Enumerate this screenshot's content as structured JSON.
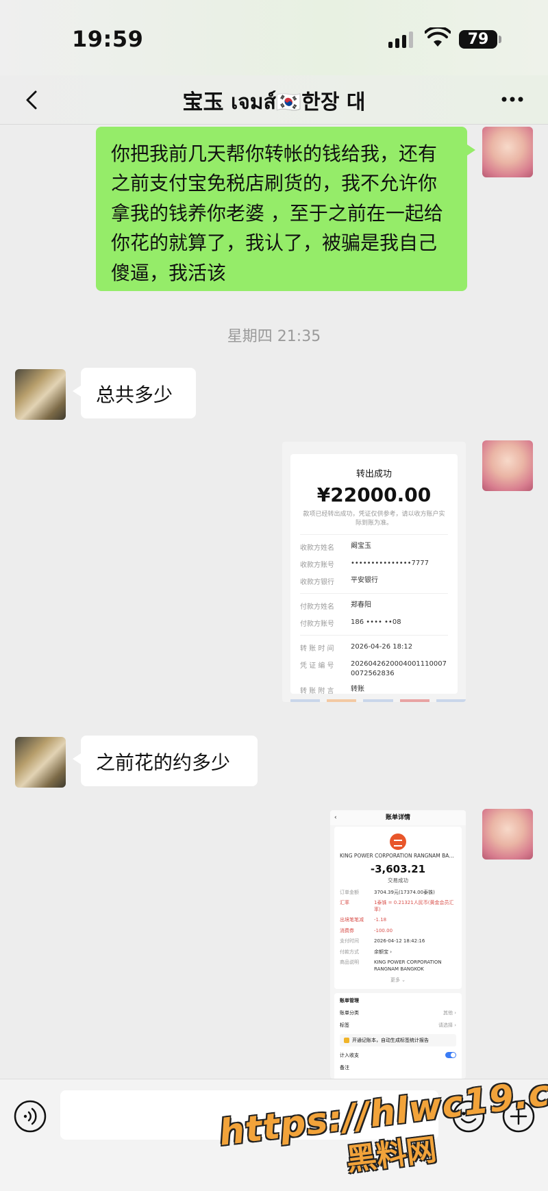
{
  "status_bar": {
    "time": "19:59",
    "battery": "79"
  },
  "header": {
    "title": "宝玉 เจมส์🇰🇷한장 대"
  },
  "messages": [
    {
      "sender": "me",
      "text": "你把我前几天帮你转帐的钱给我，还有之前支付宝免税店刷货的，我不允许你拿我的钱养你老婆 ，至于之前在一起给你花的就算了，我认了，被骗是我自己傻逼，我活该"
    },
    {
      "type": "timestamp",
      "text": "星期四 21:35"
    },
    {
      "sender": "other",
      "text": "总共多少"
    },
    {
      "sender": "me",
      "type": "image",
      "image": "transfer-receipt"
    },
    {
      "sender": "other",
      "text": "之前花的约多少"
    },
    {
      "sender": "me",
      "type": "image",
      "image": "bill-detail"
    }
  ],
  "receipt1": {
    "title": "转出成功",
    "amount": "¥22000.00",
    "note": "款项已经转出成功，凭证仅供参考，请以收方账户实际到账为准。",
    "payee_name_label": "收款方姓名",
    "payee_name": "阚宝玉",
    "payee_account_label": "收款方账号",
    "payee_account": "•••••••••••••••7777",
    "payee_bank_label": "收款方银行",
    "payee_bank": "平安银行",
    "payer_name_label": "付款方姓名",
    "payer_name": "郑春阳",
    "payer_account_label": "付款方账号",
    "payer_account": "186 •••• ••08",
    "time_label": "转 账 时 间",
    "time": "2026-04-26 18:12",
    "voucher_label": "凭 证 编 号",
    "voucher": "2026042620004001110007007​2562836",
    "memo_label": "转 账 附 言",
    "memo": "转账"
  },
  "receipt2": {
    "header": "账单详情",
    "merchant": "KING POWER CORPORATION RANGNAM BAN...",
    "amount": "-3,603.21",
    "status": "交易成功",
    "rows": [
      {
        "k": "订单金额",
        "v": "3704.39元(17374.00泰铢)",
        "red": false
      },
      {
        "k": "汇率",
        "v": "1泰铢 = 0.21321人民币(黄金会员汇率)",
        "red": true
      },
      {
        "k": "出境笔笔减",
        "v": "-1.18",
        "red": true
      },
      {
        "k": "消费券",
        "v": "-100.00",
        "red": true
      },
      {
        "k": "支付时间",
        "v": "2026-04-12 18:42:16",
        "red": false
      },
      {
        "k": "付款方式",
        "v": "余额宝 ›",
        "red": false
      },
      {
        "k": "商品说明",
        "v": "KING POWER CORPORATION RANGNAM BANGKOK",
        "red": false
      }
    ],
    "more": "更多 ⌄",
    "mgmt_title": "账单管理",
    "category_label": "账单分类",
    "category_value": "其他 ›",
    "tag_label": "标签",
    "tag_value": "请选择 ›",
    "banner_text": "开通记账本，自动生成标签统计报告",
    "count_label": "计入收支",
    "note_label": "备注"
  },
  "input": {
    "placeholder": ""
  },
  "watermark": {
    "url": "https://hlwc19.com",
    "brand": "黑料网"
  }
}
